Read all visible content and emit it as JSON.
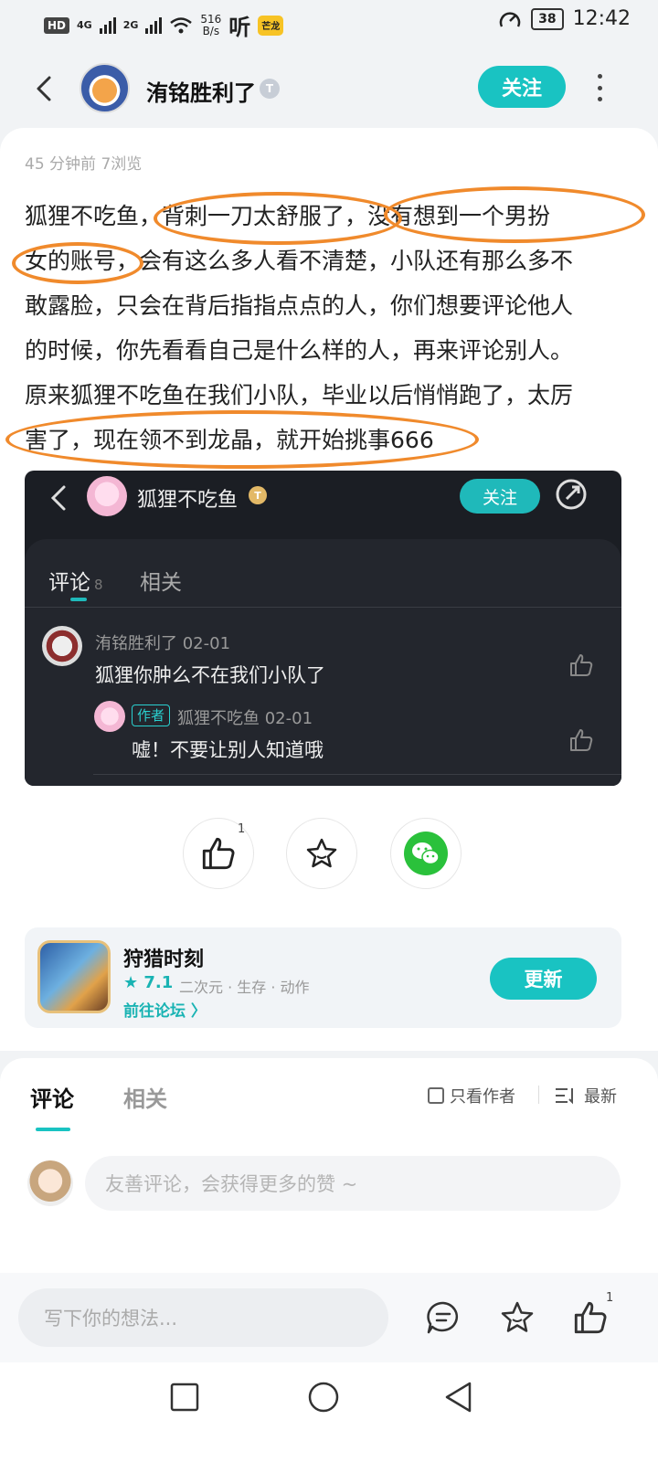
{
  "status_bar": {
    "hd": "HD",
    "sig1": "4G",
    "sig2": "2G",
    "speed_value": "516",
    "speed_unit": "B/s",
    "listen": "听",
    "app_badge": "芒龙",
    "battery": "38",
    "time": "12:42"
  },
  "header": {
    "author": "洧铭胜利了",
    "badge": "T",
    "follow": "关注"
  },
  "post": {
    "meta": "45 分钟前   7浏览",
    "lines": [
      "狐狸不吃鱼，背刺一刀太舒服了，没有想到一个男扮",
      "女的账号，会有这么多人看不清楚，小队还有那么多不",
      "敢露脸，只会在背后指指点点的人，你们想要评论他人",
      "的时候，你先看看自己是什么样的人，再来评论别人。",
      "原来狐狸不吃鱼在我们小队，毕业以后悄悄跑了，太厉",
      "害了，现在领不到龙晶，就开始挑事666"
    ]
  },
  "screenshot": {
    "name": "狐狸不吃鱼",
    "badge": "T",
    "follow": "关注",
    "tab_comments": "评论",
    "tab_comments_count": "8",
    "tab_related": "相关",
    "comment1": {
      "user": "洧铭胜利了 02-01",
      "text": "狐狸你肿么不在我们小队了"
    },
    "comment2": {
      "tag": "作者",
      "user": "狐狸不吃鱼 02-01",
      "text": "嘘！不要让别人知道哦"
    }
  },
  "actions": {
    "like_count": "1"
  },
  "game": {
    "title": "狩猎时刻",
    "score": "★ 7.1",
    "tags": "二次元 · 生存 · 动作",
    "link": "前往论坛 〉",
    "button": "更新"
  },
  "comments": {
    "tab_comments": "评论",
    "tab_related": "相关",
    "only_author": "只看作者",
    "sort": "最新",
    "placeholder": "友善评论，会获得更多的赞 ~"
  },
  "bottom_bar": {
    "placeholder": "写下你的想法...",
    "like_count": "1"
  },
  "colors": {
    "accent": "#19c3c2",
    "highlight_ring": "#f08a2c"
  }
}
